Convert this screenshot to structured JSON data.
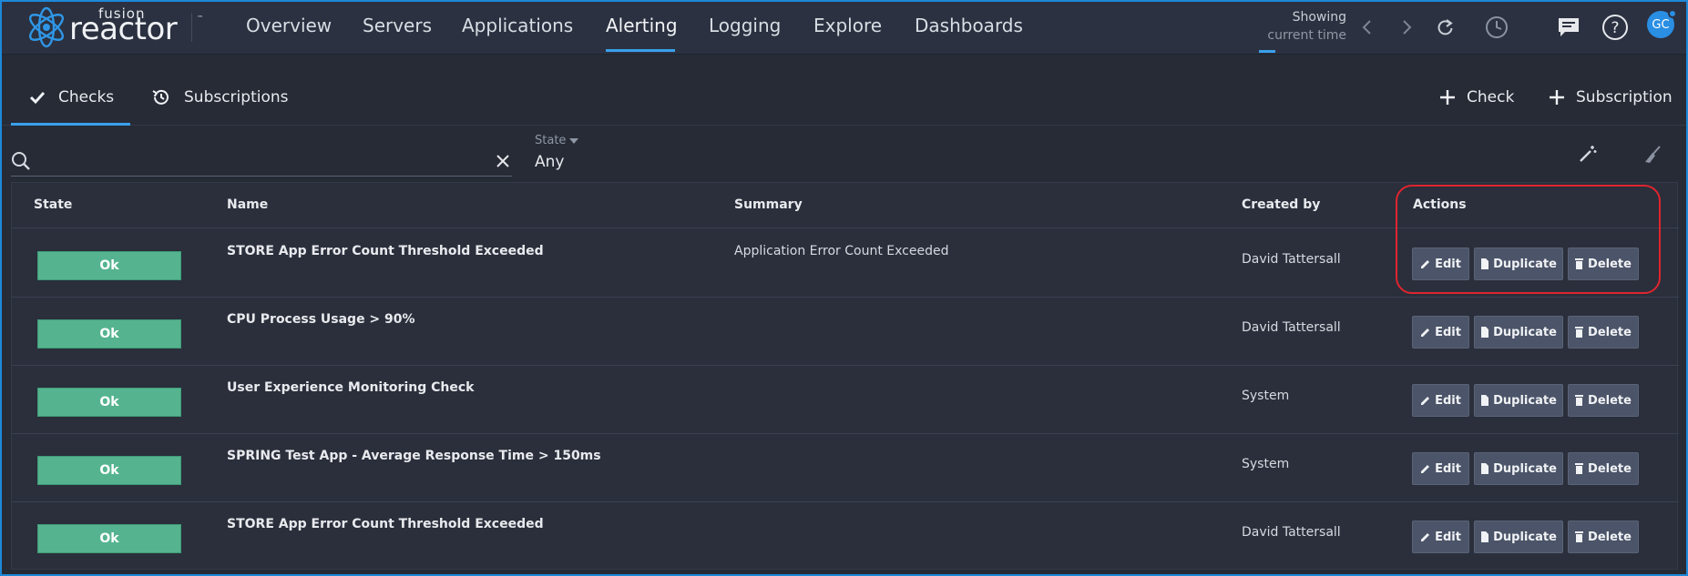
{
  "app": {
    "logo_small": "fusion",
    "logo_big": "reactor",
    "logo_tm": "™"
  },
  "nav": {
    "items": [
      {
        "label": "Overview"
      },
      {
        "label": "Servers"
      },
      {
        "label": "Applications"
      },
      {
        "label": "Alerting",
        "active": true
      },
      {
        "label": "Logging"
      },
      {
        "label": "Explore"
      },
      {
        "label": "Dashboards"
      }
    ],
    "showing_line1": "Showing",
    "showing_line2": "current time",
    "avatar_initials": "GC"
  },
  "tabs": [
    {
      "label": "Checks",
      "icon": "check-icon",
      "active": true
    },
    {
      "label": "Subscriptions",
      "icon": "history-icon"
    }
  ],
  "add_buttons": {
    "check": "Check",
    "subscription": "Subscription"
  },
  "filter": {
    "search_value": "",
    "state_label": "State",
    "state_value": "Any"
  },
  "table": {
    "headers": {
      "state": "State",
      "name": "Name",
      "summary": "Summary",
      "created_by": "Created by",
      "actions": "Actions"
    },
    "action_labels": {
      "edit": "Edit",
      "duplicate": "Duplicate",
      "delete": "Delete"
    },
    "rows": [
      {
        "state": "Ok",
        "name": "STORE App Error Count Threshold Exceeded",
        "summary": "Application Error Count Exceeded",
        "created_by": "David Tattersall"
      },
      {
        "state": "Ok",
        "name": "CPU Process Usage > 90%",
        "summary": "",
        "created_by": "David Tattersall"
      },
      {
        "state": "Ok",
        "name": "User Experience Monitoring Check",
        "summary": "",
        "created_by": "System"
      },
      {
        "state": "Ok",
        "name": "SPRING Test App - Average Response Time > 150ms",
        "summary": "",
        "created_by": "System"
      },
      {
        "state": "Ok",
        "name": "STORE App Error Count Threshold Exceeded",
        "summary": "",
        "created_by": "David Tattersall"
      }
    ]
  },
  "colors": {
    "accent": "#3aa0ec",
    "ok": "#55b48f",
    "highlight": "#e0242e"
  }
}
